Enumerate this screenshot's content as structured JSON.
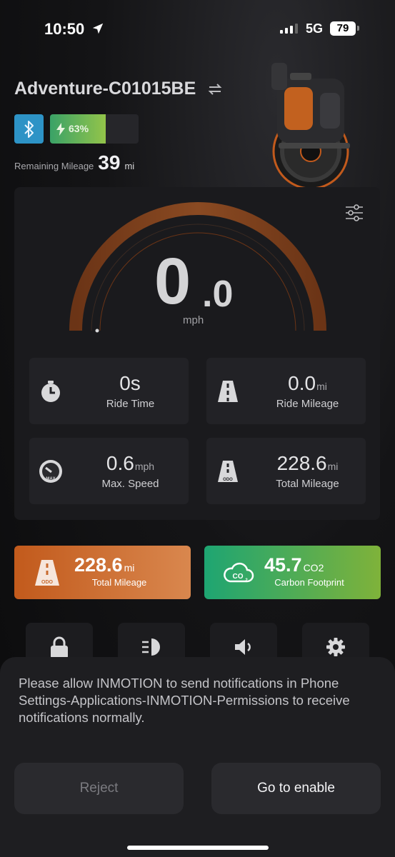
{
  "status_bar": {
    "time": "10:50",
    "network": "5G",
    "battery": "79"
  },
  "header": {
    "device_name": "Adventure-C01015BE",
    "battery_percent_label": "63%",
    "battery_level": 0.63,
    "remaining_label": "Remaining Mileage",
    "remaining_value": "39",
    "remaining_unit": "mi"
  },
  "speed": {
    "integer": "0",
    "decimal": ".0",
    "unit": "mph"
  },
  "stats": [
    {
      "value": "0s",
      "unit": "",
      "label": "Ride Time",
      "icon": "stopwatch-icon"
    },
    {
      "value": "0.0",
      "unit": "mi",
      "label": "Ride Mileage",
      "icon": "road-icon"
    },
    {
      "value": "0.6",
      "unit": "mph",
      "label": "Max. Speed",
      "icon": "speedometer-max-icon"
    },
    {
      "value": "228.6",
      "unit": "mi",
      "label": "Total Mileage",
      "icon": "odometer-road-icon"
    }
  ],
  "tiles": {
    "total_mileage": {
      "value": "228.6",
      "unit": "mi",
      "label": "Total Mileage"
    },
    "carbon": {
      "value": "45.7",
      "unit": "CO2",
      "label": "Carbon Footprint"
    }
  },
  "quick_buttons": [
    "lock-icon",
    "headlight-icon",
    "speaker-icon",
    "gear-icon"
  ],
  "sheet": {
    "message": "Please allow INMOTION to send notifications in Phone Settings-Applications-INMOTION-Permissions to receive notifications normally.",
    "reject_label": "Reject",
    "enable_label": "Go to enable"
  },
  "colors": {
    "accent_orange": "#c25a1c",
    "accent_green": "#1ea572",
    "bluetooth": "#2d93c6"
  }
}
